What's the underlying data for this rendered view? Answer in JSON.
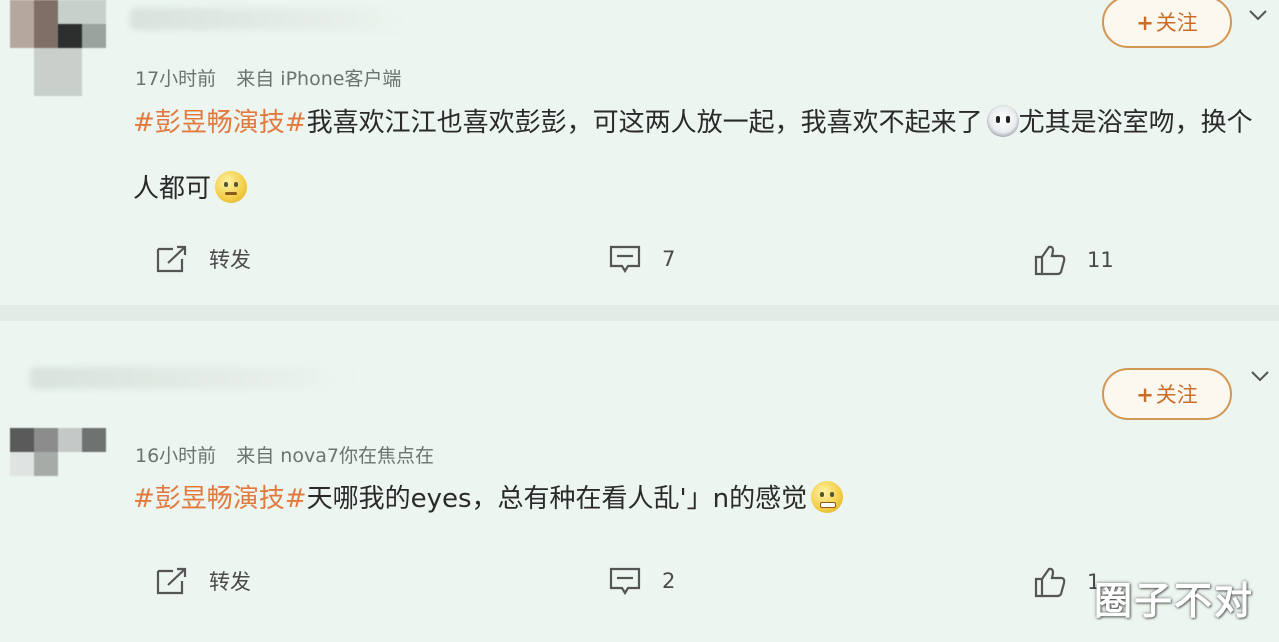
{
  "posts": [
    {
      "time": "17小时前",
      "source_label": "来自",
      "source": "iPhone客户端",
      "hashtag": "#彭昱畅演技#",
      "text_a": "我喜欢江江也喜欢彭彭，可这两人放一起，我喜欢不起来了",
      "text_b": "尤其是浴室吻，换个人都可",
      "emoji_mid": "dizzy-face-emoji",
      "emoji_end": "nauseated-face-emoji",
      "follow_label": "关注",
      "repost_label": "转发",
      "comment_count": "7",
      "like_count": "11"
    },
    {
      "time": "16小时前",
      "source_label": "来自",
      "source": "nova7你在焦点在",
      "hashtag": "#彭昱畅演技#",
      "text_a": "天哪我的eyes，总有种在看人乱'」n的感觉",
      "emoji_end": "grimacing-face-emoji",
      "follow_label": "关注",
      "repost_label": "转发",
      "comment_count": "2",
      "like_count": "1"
    }
  ],
  "watermark": "圈子不对",
  "colors": {
    "accent": "#e27a3f",
    "background": "#ecf5ef",
    "follow_border": "#d49654"
  }
}
